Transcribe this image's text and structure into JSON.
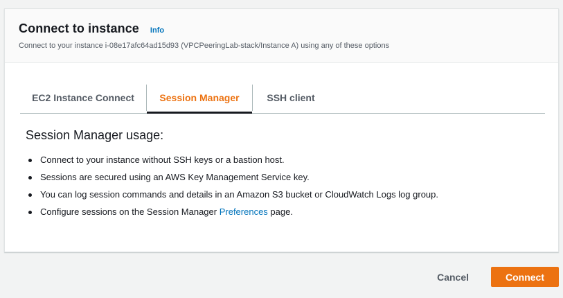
{
  "header": {
    "title": "Connect to instance",
    "info_label": "Info",
    "subtitle": "Connect to your instance i-08e17afc64ad15d93 (VPCPeeringLab-stack/Instance A) using any of these options"
  },
  "tabs": [
    {
      "label": "EC2 Instance Connect",
      "active": false
    },
    {
      "label": "Session Manager",
      "active": true
    },
    {
      "label": "SSH client",
      "active": false
    }
  ],
  "content": {
    "heading": "Session Manager usage:",
    "bullets": [
      "Connect to your instance without SSH keys or a bastion host.",
      "Sessions are secured using an AWS Key Management Service key.",
      "You can log session commands and details in an Amazon S3 bucket or CloudWatch Logs log group."
    ],
    "last_bullet": {
      "prefix": "Configure sessions on the Session Manager ",
      "link": "Preferences",
      "suffix": " page."
    }
  },
  "footer": {
    "cancel_label": "Cancel",
    "connect_label": "Connect"
  },
  "colors": {
    "accent": "#ec7211",
    "link": "#0073bb",
    "text": "#16191f",
    "muted": "#545b64"
  }
}
